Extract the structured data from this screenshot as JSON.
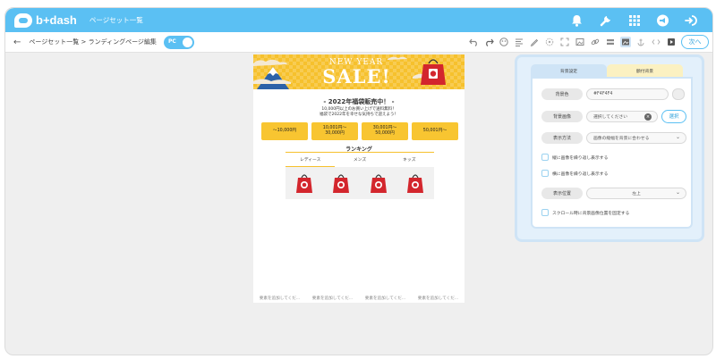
{
  "header": {
    "logo_text": "b+dash",
    "title": "ページセット一覧",
    "icons": [
      "bell-icon",
      "wrench-icon",
      "grid-icon",
      "megaphone-icon",
      "logout-icon"
    ]
  },
  "toolbar": {
    "back_icon": "←",
    "breadcrumb": "ページセット一覧 > ランディングページ編集",
    "device_toggle": "PC",
    "next_label": "次へ"
  },
  "preview": {
    "banner_line1": "NEW YEAR",
    "banner_line2": "SALE!",
    "sale_title": "- 2022年福袋販売中！ -",
    "sale_sub1": "10,000円以上のお買い上げで送料無料！",
    "sale_sub2": "福袋で2022年を幸せな気持ちで迎えよう！",
    "prices": [
      {
        "label": "〜10,000円"
      },
      {
        "line1": "10,001円〜",
        "line2": "30,000円"
      },
      {
        "line1": "30,001円〜",
        "line2": "50,000円"
      },
      {
        "label": "50,001円〜"
      }
    ],
    "ranking_title": "ランキング",
    "ranking_tabs": [
      "レディース",
      "メンズ",
      "キッズ"
    ],
    "placeholder_text": "要素を追加してくだ..."
  },
  "panel": {
    "tab_active": "背景設定",
    "tab_inactive": "額付背景",
    "bg_color_label": "背景色",
    "bg_color_value": "#F4F4F4",
    "bg_image_label": "背景画像",
    "bg_image_placeholder": "選択してください",
    "select_button": "選択",
    "display_method_label": "表示方法",
    "display_method_value": "画像の縦幅を背景に合わせる",
    "repeat_vertical_label": "縦に画像を繰り返し表示する",
    "repeat_horizontal_label": "横に画像を繰り返し表示する",
    "display_position_label": "表示位置",
    "display_position_value": "左上",
    "fixed_on_scroll_label": "スクロール時に背景画像位置を固定する"
  },
  "colors": {
    "accent": "#5bc0f3",
    "banner": "#f6c12d",
    "price_button": "#f8c531",
    "bag_red": "#d3262d"
  }
}
